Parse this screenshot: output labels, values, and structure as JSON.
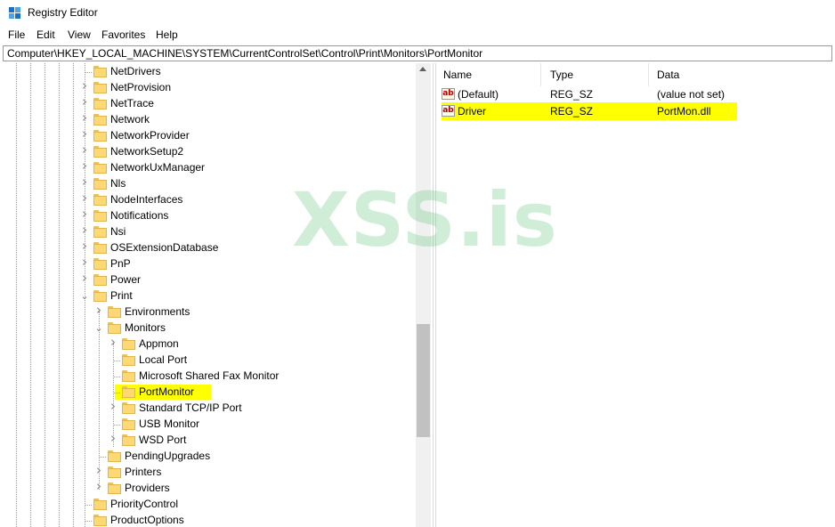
{
  "window": {
    "title": "Registry Editor"
  },
  "menu": [
    "File",
    "Edit",
    "View",
    "Favorites",
    "Help"
  ],
  "address": "Computer\\HKEY_LOCAL_MACHINE\\SYSTEM\\CurrentControlSet\\Control\\Print\\Monitors\\PortMonitor",
  "tree": {
    "items": [
      {
        "label": "NetDrivers",
        "expander": "none"
      },
      {
        "label": "NetProvision",
        "expander": "collapsed"
      },
      {
        "label": "NetTrace",
        "expander": "collapsed"
      },
      {
        "label": "Network",
        "expander": "collapsed"
      },
      {
        "label": "NetworkProvider",
        "expander": "collapsed"
      },
      {
        "label": "NetworkSetup2",
        "expander": "collapsed"
      },
      {
        "label": "NetworkUxManager",
        "expander": "collapsed"
      },
      {
        "label": "Nls",
        "expander": "collapsed"
      },
      {
        "label": "NodeInterfaces",
        "expander": "collapsed"
      },
      {
        "label": "Notifications",
        "expander": "collapsed"
      },
      {
        "label": "Nsi",
        "expander": "collapsed"
      },
      {
        "label": "OSExtensionDatabase",
        "expander": "collapsed"
      },
      {
        "label": "PnP",
        "expander": "collapsed"
      },
      {
        "label": "Power",
        "expander": "collapsed"
      },
      {
        "label": "Print",
        "expander": "expanded"
      },
      {
        "label": "Environments",
        "expander": "collapsed"
      },
      {
        "label": "Monitors",
        "expander": "expanded"
      },
      {
        "label": "Appmon",
        "expander": "collapsed"
      },
      {
        "label": "Local Port",
        "expander": "none"
      },
      {
        "label": "Microsoft Shared Fax Monitor",
        "expander": "none"
      },
      {
        "label": "PortMonitor",
        "expander": "none",
        "selected": true
      },
      {
        "label": "Standard TCP/IP Port",
        "expander": "collapsed"
      },
      {
        "label": "USB Monitor",
        "expander": "none"
      },
      {
        "label": "WSD Port",
        "expander": "collapsed"
      },
      {
        "label": "PendingUpgrades",
        "expander": "none"
      },
      {
        "label": "Printers",
        "expander": "collapsed"
      },
      {
        "label": "Providers",
        "expander": "collapsed"
      },
      {
        "label": "PriorityControl",
        "expander": "none"
      },
      {
        "label": "ProductOptions",
        "expander": "none"
      }
    ]
  },
  "list": {
    "columns": [
      "Name",
      "Type",
      "Data"
    ],
    "rows": [
      {
        "name": "(Default)",
        "type": "REG_SZ",
        "data": "(value not set)",
        "icon": "ab-string-icon"
      },
      {
        "name": "Driver",
        "type": "REG_SZ",
        "data": "PortMon.dll",
        "icon": "ab-string-icon",
        "highlighted": true
      }
    ]
  },
  "watermark": "XSS.is",
  "colors": {
    "highlight": "#ffff00",
    "folder": "#fcd974",
    "watermark": "#78cd8c"
  }
}
